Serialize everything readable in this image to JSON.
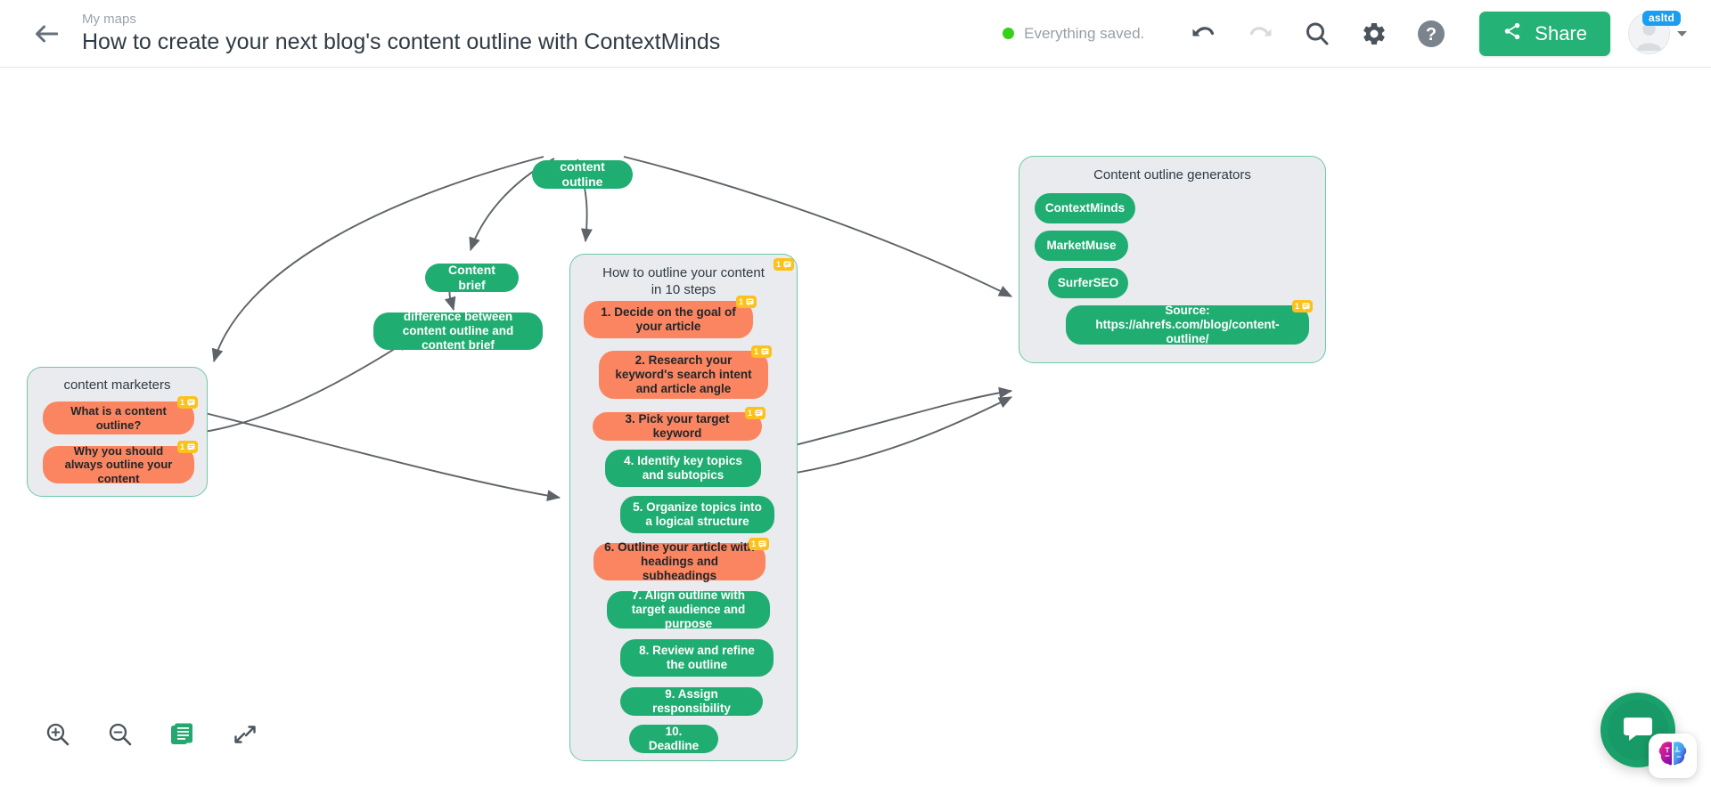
{
  "header": {
    "back_icon": "arrow-left-icon",
    "breadcrumb": "My maps",
    "title": "How to create your next blog's content outline with ContextMinds",
    "save_status": "Everything saved.",
    "save_dot_color": "#36d117",
    "undo_icon": "undo-icon",
    "redo_icon": "redo-icon",
    "search_icon": "search-icon",
    "settings_icon": "gear-icon",
    "help_icon": "question-mark-icon",
    "share_label": "Share",
    "share_icon": "share-icon",
    "share_color": "#25b277",
    "avatar_badge": "asltd",
    "avatar_icon": "user-avatar-icon",
    "caret_icon": "chevron-down-icon"
  },
  "canvas": {
    "root_node": "content outline",
    "nodes": {
      "content_brief": "Content brief",
      "difference": "difference between content outline and content brief"
    },
    "groups": [
      {
        "id": "content-marketers",
        "title": "content marketers",
        "items": [
          {
            "label": "What is a content outline?",
            "color": "orange",
            "badge": "1"
          },
          {
            "label": "Why you should always outline your content",
            "color": "orange",
            "badge": "1"
          }
        ]
      },
      {
        "id": "how-to-outline",
        "title": "How to outline your content in 10 steps",
        "badge": "1",
        "items": [
          {
            "label": "1. Decide on the goal of your article",
            "color": "orange",
            "badge": "1"
          },
          {
            "label": "2. Research your keyword's search intent and article angle",
            "color": "orange",
            "badge": "1"
          },
          {
            "label": "3. Pick your target keyword",
            "color": "orange",
            "badge": "1"
          },
          {
            "label": "4. Identify key topics and subtopics",
            "color": "green",
            "badge": null
          },
          {
            "label": "5. Organize topics into a logical structure",
            "color": "green",
            "badge": null
          },
          {
            "label": "6. Outline your article with headings and subheadings",
            "color": "orange",
            "badge": "1"
          },
          {
            "label": "7. Align outline with target audience and purpose",
            "color": "green",
            "badge": null
          },
          {
            "label": "8. Review and refine the outline",
            "color": "green",
            "badge": null
          },
          {
            "label": "9. Assign responsibility",
            "color": "green",
            "badge": null
          },
          {
            "label": "10. Deadline",
            "color": "green",
            "badge": null
          }
        ]
      },
      {
        "id": "generators",
        "title": "Content outline generators",
        "items": [
          {
            "label": "ContextMinds",
            "color": "green",
            "badge": null
          },
          {
            "label": "MarketMuse",
            "color": "green",
            "badge": null
          },
          {
            "label": "SurferSEO",
            "color": "green",
            "badge": null
          },
          {
            "label": "Source: https://ahrefs.com/blog/content-outline/",
            "color": "green",
            "badge": "1"
          }
        ]
      }
    ],
    "colors": {
      "green": "#20ad72",
      "orange": "#fa8560",
      "group_bg": "#e9ebee",
      "group_border": "#6cc9a3",
      "badge": "#fcc11a",
      "edge": "#5d6368"
    }
  },
  "bottom_tools": [
    {
      "name": "zoom-in-icon",
      "label": "Zoom in"
    },
    {
      "name": "zoom-out-icon",
      "label": "Zoom out"
    },
    {
      "name": "notes-icon",
      "label": "Notes"
    },
    {
      "name": "fit-screen-icon",
      "label": "Fit to screen"
    }
  ],
  "floating": {
    "chat_icon": "chat-bubble-icon",
    "brain_icon": "brain-icon"
  }
}
